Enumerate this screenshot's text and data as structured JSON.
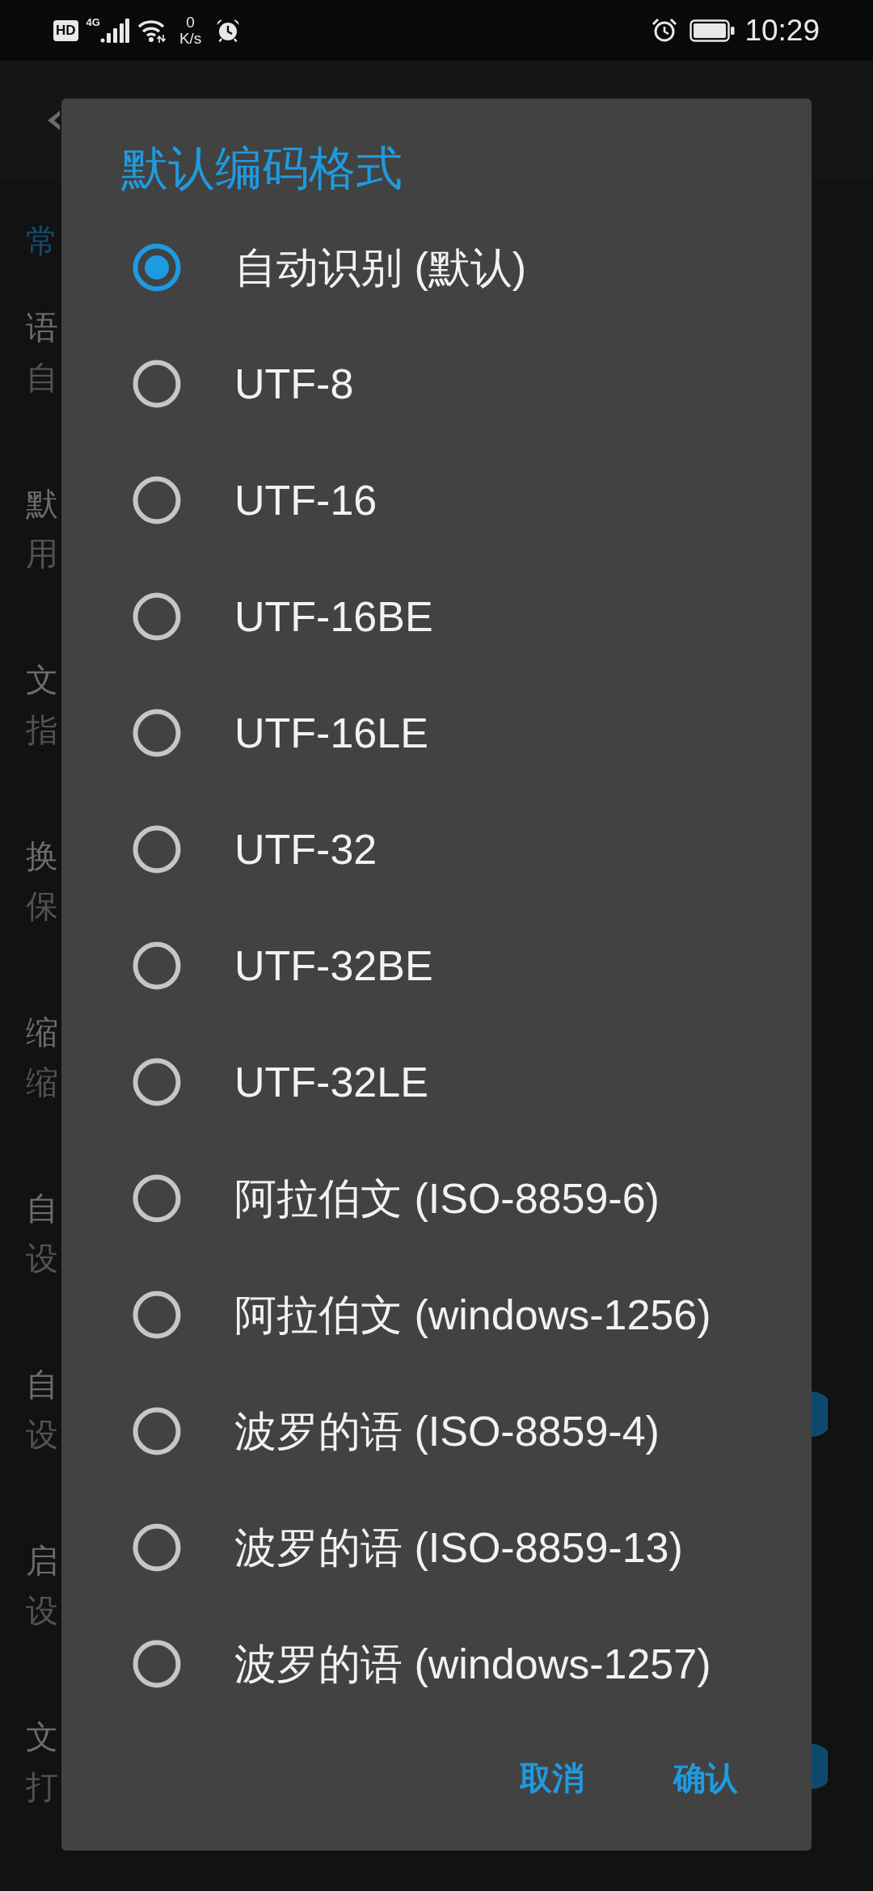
{
  "status_bar": {
    "hd_badge": "HD",
    "network_type": "4G",
    "net_speed": {
      "value": "0",
      "unit": "K/s"
    },
    "time": "10:29"
  },
  "settings_page": {
    "section_header": "常",
    "rows": [
      {
        "title": "语",
        "summary": "自"
      },
      {
        "title": "默",
        "summary": "用"
      },
      {
        "title": "文",
        "summary": "指"
      },
      {
        "title": "换",
        "summary": "保"
      },
      {
        "title": "缩",
        "summary": "缩"
      },
      {
        "title": "自",
        "summary": "设"
      },
      {
        "title": "自",
        "summary": "设",
        "switch_on": true
      },
      {
        "title": "启",
        "summary": "设"
      },
      {
        "title": "文",
        "summary": "打",
        "switch_on": true
      }
    ]
  },
  "dialog": {
    "title": "默认编码格式",
    "options": [
      {
        "label": "自动识别 (默认)",
        "selected": true
      },
      {
        "label": "UTF-8",
        "selected": false
      },
      {
        "label": "UTF-16",
        "selected": false
      },
      {
        "label": "UTF-16BE",
        "selected": false
      },
      {
        "label": "UTF-16LE",
        "selected": false
      },
      {
        "label": "UTF-32",
        "selected": false
      },
      {
        "label": "UTF-32BE",
        "selected": false
      },
      {
        "label": "UTF-32LE",
        "selected": false
      },
      {
        "label": "阿拉伯文 (ISO-8859-6)",
        "selected": false
      },
      {
        "label": "阿拉伯文 (windows-1256)",
        "selected": false
      },
      {
        "label": "波罗的语 (ISO-8859-4)",
        "selected": false
      },
      {
        "label": "波罗的语 (ISO-8859-13)",
        "selected": false
      },
      {
        "label": "波罗的语 (windows-1257)",
        "selected": false
      }
    ],
    "buttons": [
      "取消",
      "确认"
    ]
  }
}
